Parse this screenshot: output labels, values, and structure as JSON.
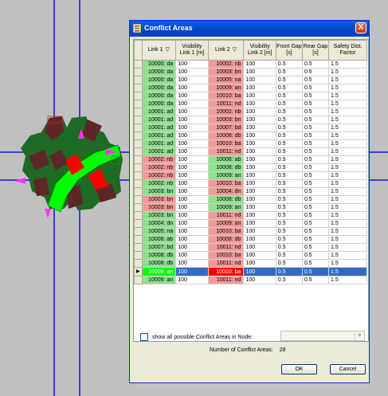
{
  "window_title": "Conflict Areas",
  "close_label": "X",
  "columns": [
    "",
    "Link 1",
    "Visibility Link 1 [m]",
    "Link 2",
    "Visibility Link 2 [m]",
    "Front Gap [s]",
    "Rear Gap [s]",
    "Safety Dist. Factor"
  ],
  "rows": [
    {
      "link1": "10000: da",
      "c1": "g",
      "vis1": "100",
      "link2": "10002: nb",
      "c2": "r",
      "vis2": "100",
      "front": "0.5",
      "rear": "0.5",
      "factor": "1.5"
    },
    {
      "link1": "10000: da",
      "c1": "g",
      "vis1": "100",
      "link2": "10003: bn",
      "c2": "r",
      "vis2": "100",
      "front": "0.5",
      "rear": "0.5",
      "factor": "1.5"
    },
    {
      "link1": "10000: da",
      "c1": "g",
      "vis1": "100",
      "link2": "10005: na",
      "c2": "r",
      "vis2": "100",
      "front": "0.5",
      "rear": "0.5",
      "factor": "1.5"
    },
    {
      "link1": "10000: da",
      "c1": "g",
      "vis1": "100",
      "link2": "10009: an",
      "c2": "r",
      "vis2": "100",
      "front": "0.5",
      "rear": "0.5",
      "factor": "1.5"
    },
    {
      "link1": "10000: da",
      "c1": "g",
      "vis1": "100",
      "link2": "10010: ba",
      "c2": "r",
      "vis2": "100",
      "front": "0.5",
      "rear": "0.5",
      "factor": "1.5"
    },
    {
      "link1": "10000: da",
      "c1": "g",
      "vis1": "100",
      "link2": "10011: nd",
      "c2": "r",
      "vis2": "100",
      "front": "0.5",
      "rear": "0.5",
      "factor": "1.5"
    },
    {
      "link1": "10001: ad",
      "c1": "g",
      "vis1": "100",
      "link2": "10002: nb",
      "c2": "r",
      "vis2": "100",
      "front": "0.5",
      "rear": "0.5",
      "factor": "1.5"
    },
    {
      "link1": "10001: ad",
      "c1": "g",
      "vis1": "100",
      "link2": "10003: bn",
      "c2": "r",
      "vis2": "100",
      "front": "0.5",
      "rear": "0.5",
      "factor": "1.5"
    },
    {
      "link1": "10001: ad",
      "c1": "g",
      "vis1": "100",
      "link2": "10007: bd",
      "c2": "r",
      "vis2": "100",
      "front": "0.5",
      "rear": "0.5",
      "factor": "1.5"
    },
    {
      "link1": "10001: ad",
      "c1": "g",
      "vis1": "100",
      "link2": "10008: db",
      "c2": "r",
      "vis2": "100",
      "front": "0.5",
      "rear": "0.5",
      "factor": "1.5"
    },
    {
      "link1": "10001: ad",
      "c1": "g",
      "vis1": "100",
      "link2": "10010: ba",
      "c2": "r",
      "vis2": "100",
      "front": "0.5",
      "rear": "0.5",
      "factor": "1.5"
    },
    {
      "link1": "10001: ad",
      "c1": "g",
      "vis1": "100",
      "link2": "10011: nd",
      "c2": "r",
      "vis2": "100",
      "front": "0.5",
      "rear": "0.5",
      "factor": "1.5"
    },
    {
      "link1": "10002: nb",
      "c1": "r",
      "vis1": "100",
      "link2": "10006: ab",
      "c2": "g",
      "vis2": "100",
      "front": "0.5",
      "rear": "0.5",
      "factor": "1.5"
    },
    {
      "link1": "10002: nb",
      "c1": "r",
      "vis1": "100",
      "link2": "10008: db",
      "c2": "g",
      "vis2": "100",
      "front": "0.5",
      "rear": "0.5",
      "factor": "1.5"
    },
    {
      "link1": "10002: nb",
      "c1": "r",
      "vis1": "100",
      "link2": "10009: an",
      "c2": "g",
      "vis2": "100",
      "front": "0.5",
      "rear": "0.5",
      "factor": "1.5"
    },
    {
      "link1": "10002: nb",
      "c1": "g",
      "vis1": "100",
      "link2": "10010: ba",
      "c2": "r",
      "vis2": "100",
      "front": "0.5",
      "rear": "0.5",
      "factor": "1.5"
    },
    {
      "link1": "10003: bn",
      "c1": "g",
      "vis1": "100",
      "link2": "10004: dn",
      "c2": "r",
      "vis2": "100",
      "front": "0.5",
      "rear": "0.5",
      "factor": "1.5"
    },
    {
      "link1": "10003: bn",
      "c1": "r",
      "vis1": "100",
      "link2": "10008: db",
      "c2": "g",
      "vis2": "100",
      "front": "0.5",
      "rear": "0.5",
      "factor": "1.5"
    },
    {
      "link1": "10003: bn",
      "c1": "r",
      "vis1": "100",
      "link2": "10009: an",
      "c2": "g",
      "vis2": "100",
      "front": "0.5",
      "rear": "0.5",
      "factor": "1.5"
    },
    {
      "link1": "10003: bn",
      "c1": "g",
      "vis1": "100",
      "link2": "10011: nd",
      "c2": "r",
      "vis2": "100",
      "front": "0.5",
      "rear": "0.5",
      "factor": "1.5"
    },
    {
      "link1": "10004: dn",
      "c1": "g",
      "vis1": "100",
      "link2": "10009: an",
      "c2": "r",
      "vis2": "100",
      "front": "0.5",
      "rear": "0.5",
      "factor": "1.5"
    },
    {
      "link1": "10005: na",
      "c1": "g",
      "vis1": "100",
      "link2": "10010: ba",
      "c2": "r",
      "vis2": "100",
      "front": "0.5",
      "rear": "0.5",
      "factor": "1.5"
    },
    {
      "link1": "10006: ab",
      "c1": "g",
      "vis1": "100",
      "link2": "10008: db",
      "c2": "r",
      "vis2": "100",
      "front": "0.5",
      "rear": "0.5",
      "factor": "1.5"
    },
    {
      "link1": "10007: bd",
      "c1": "g",
      "vis1": "100",
      "link2": "10011: nd",
      "c2": "r",
      "vis2": "100",
      "front": "0.5",
      "rear": "0.5",
      "factor": "1.5"
    },
    {
      "link1": "10008: db",
      "c1": "g",
      "vis1": "100",
      "link2": "10010: ba",
      "c2": "r",
      "vis2": "100",
      "front": "0.5",
      "rear": "0.5",
      "factor": "1.5"
    },
    {
      "link1": "10008: db",
      "c1": "g",
      "vis1": "100",
      "link2": "10011: nd",
      "c2": "r",
      "vis2": "100",
      "front": "0.5",
      "rear": "0.5",
      "factor": "1.5"
    },
    {
      "link1": "10009: an",
      "c1": "sg",
      "vis1": "100",
      "link2": "10010: ba",
      "c2": "sr",
      "vis2": "100",
      "front": "0.5",
      "rear": "0.5",
      "factor": "1.5",
      "selected": true
    },
    {
      "link1": "10009: an",
      "c1": "g",
      "vis1": "100",
      "link2": "10011: nd",
      "c2": "r",
      "vis2": "100",
      "front": "0.5",
      "rear": "0.5",
      "factor": "1.5"
    }
  ],
  "show_all_label": "show all possible Conflict Areas in Node:",
  "count_label": "Number of Conflict Areas:",
  "count_value": "28",
  "ok_label": "OK",
  "cancel_label": "Cancel",
  "colors": {
    "background": "#c0c0c0",
    "link_green": "#1f6a25",
    "link_dark": "#5e2626",
    "conflict_green": "#00ff00",
    "conflict_red": "#ff0000",
    "axis_line": "#1515d4",
    "cell_green": "#8fe08f",
    "cell_red": "#f29a9a",
    "selection": "#316ac5"
  }
}
